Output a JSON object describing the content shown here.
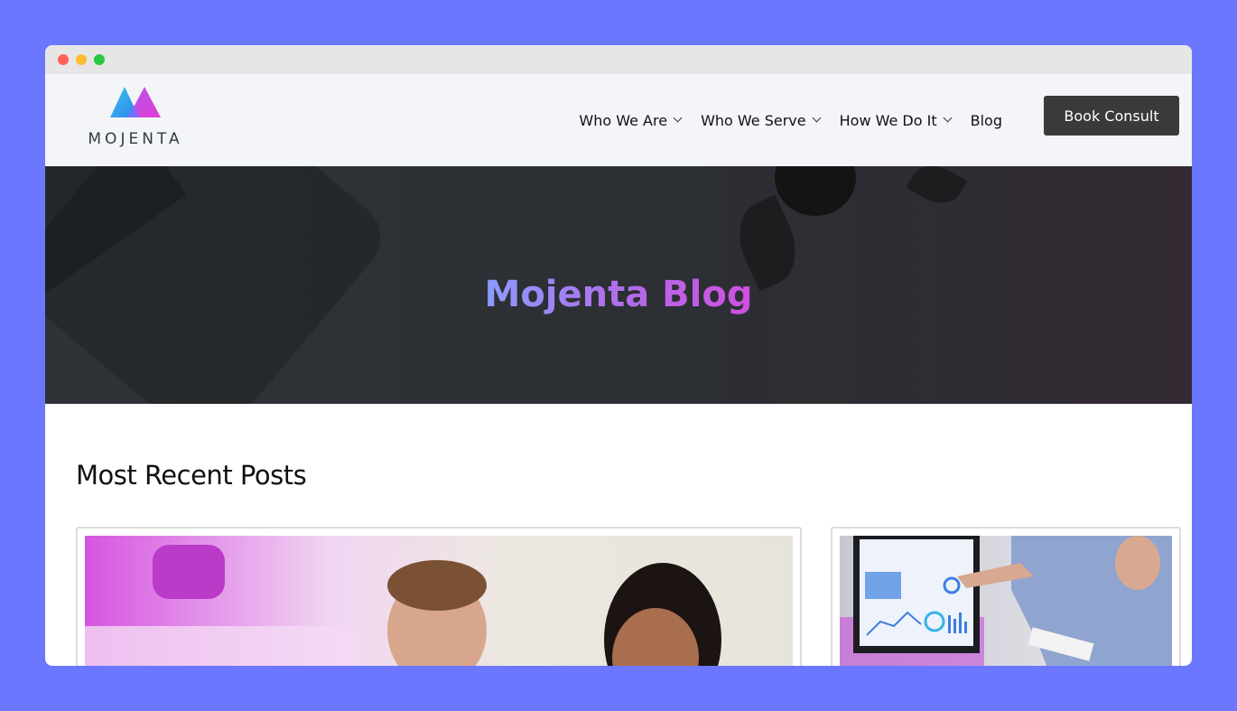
{
  "logo": {
    "text": "MOJENTA"
  },
  "nav": {
    "items": [
      {
        "label": "Who We Are"
      },
      {
        "label": "Who We Serve"
      },
      {
        "label": "How We Do It"
      },
      {
        "label": "Blog"
      }
    ],
    "cta": "Book Consult"
  },
  "hero": {
    "title": "Mojenta Blog"
  },
  "main": {
    "section_title": "Most Recent Posts"
  },
  "colors": {
    "background": "#6b77ff",
    "header_bg": "#f3f5f9",
    "cta_bg": "#3a3a3a",
    "title_gradient_start": "#8b9cff",
    "title_gradient_end": "#d04fe0"
  }
}
